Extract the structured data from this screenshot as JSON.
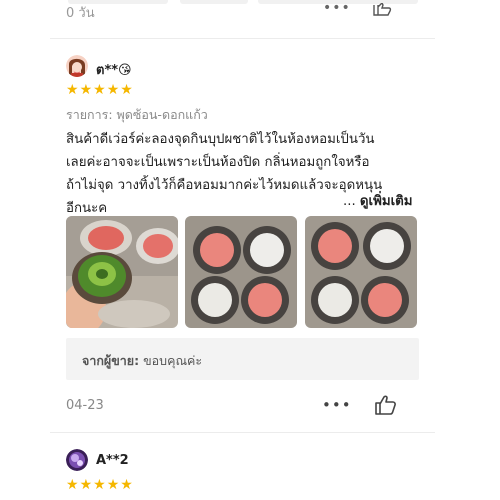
{
  "top": {
    "date_partial": "0 วัน",
    "more_label": "•••"
  },
  "review1": {
    "username": "ต**😘",
    "rating": 5,
    "stars": [
      "★",
      "★",
      "★",
      "★",
      "★"
    ],
    "product_label": "รายการ: พุดซ้อน-ดอกแก้ว",
    "text_lines": [
      "สินค้าดีเว่อร์ค่ะลองจุดกินบุปผชาติไว้ในห้องหอมเป็นวัน",
      "เลยค่ะอาจจะเป็นเพราะเป็นห้องปิด   กลิ่นหอมถูกใจหรือ",
      "ถ้าไม่จุด    วางทิ้งไว้ก็คือหอมมากค่ะไว้หมดแล้วจะอุดหนุน",
      "อีกนะค"
    ],
    "see_more_ellipsis": "...",
    "see_more": "ดูเพิ่มเติม",
    "seller_label": "จากผู้ขาย:",
    "seller_reply": "ขอบคุณค่ะ",
    "date": "04-23",
    "more_label": "•••"
  },
  "review2": {
    "username": "A**2",
    "rating": 5,
    "stars": [
      "★",
      "★",
      "★",
      "★",
      "★"
    ]
  },
  "colors": {
    "star": "#f5b700",
    "seller_box": "#f3f3f3"
  }
}
